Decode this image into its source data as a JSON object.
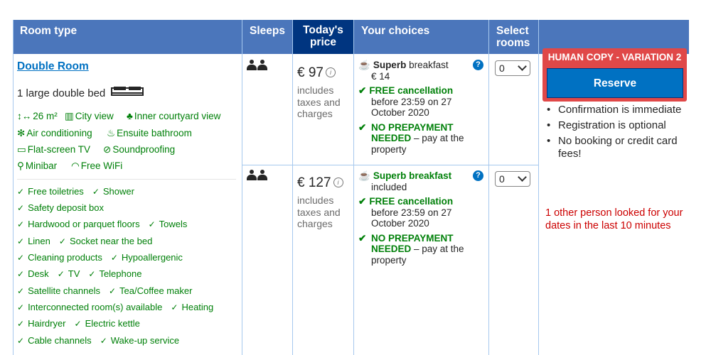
{
  "headers": {
    "room_type": "Room type",
    "sleeps": "Sleeps",
    "todays_price": "Today's price",
    "your_choices": "Your choices",
    "select_rooms": "Select rooms"
  },
  "room": {
    "name": "Double Room",
    "bed": "1 large double bed",
    "facilities": [
      {
        "icon": "room-size-icon",
        "label": "26 m²"
      },
      {
        "icon": "city-view-icon",
        "label": "City view"
      },
      {
        "icon": "courtyard-icon",
        "label": "Inner courtyard view"
      },
      {
        "icon": "snowflake-icon",
        "label": "Air conditioning"
      },
      {
        "icon": "bath-icon",
        "label": "Ensuite bathroom"
      },
      {
        "icon": "tv-icon",
        "label": "Flat-screen TV"
      },
      {
        "icon": "soundproof-icon",
        "label": "Soundproofing"
      },
      {
        "icon": "minibar-icon",
        "label": "Minibar"
      },
      {
        "icon": "wifi-icon",
        "label": "Free WiFi"
      }
    ],
    "amenities": [
      "Free toiletries",
      "Shower",
      "Safety deposit box",
      "Hardwood or parquet floors",
      "Towels",
      "Linen",
      "Socket near the bed",
      "Cleaning products",
      "Hypoallergenic",
      "Desk",
      "TV",
      "Telephone",
      "Satellite channels",
      "Tea/Coffee maker",
      "Interconnected room(s) available",
      "Heating",
      "Hairdryer",
      "Electric kettle",
      "Cable channels",
      "Wake-up service"
    ]
  },
  "options": [
    {
      "price": "€ 97",
      "price_note": "includes taxes and charges",
      "breakfast_bold": "Superb",
      "breakfast_rest": " breakfast",
      "breakfast_detail": "€ 14",
      "cancel_title": "FREE cancellation",
      "cancel_detail": "before 23:59 on 27 October 2020",
      "prepay_title": "NO PREPAYMENT NEEDED",
      "prepay_detail": " – pay at the property",
      "select_value": "0"
    },
    {
      "price": "€ 127",
      "price_note": "includes taxes and charges",
      "breakfast_bold": "Superb breakfast",
      "breakfast_rest": "",
      "breakfast_detail": "included",
      "cancel_title": "FREE cancellation",
      "cancel_detail": "before 23:59 on 27 October 2020",
      "prepay_title": "NO PREPAYMENT NEEDED",
      "prepay_detail": " – pay at the property",
      "select_value": "0"
    }
  ],
  "sidebar": {
    "badge": "HUMAN COPY - VARIATION 2",
    "reserve_label": "Reserve",
    "bullets": [
      "Confirmation is immediate",
      "Registration is optional",
      "No booking or credit card fees!"
    ],
    "urgency": "1 other person looked for your dates in the last 10 minutes"
  },
  "colors": {
    "header_blue": "#4b76bb",
    "header_dark": "#003580",
    "link_blue": "#0071c2",
    "green": "#008009",
    "badge_red": "#e04848",
    "urgency_red": "#cc0000"
  }
}
